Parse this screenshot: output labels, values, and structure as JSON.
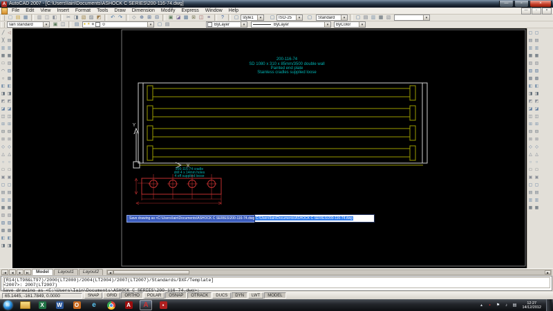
{
  "window": {
    "title": "AutoCAD 2007 - [C:\\Users\\Iain\\Documents\\ASHOCK C SERIES\\200-116-74.dwg]",
    "app_icon_glyph": "A",
    "controls": {
      "minimize": "—",
      "maximize": "▫",
      "close": "×"
    }
  },
  "ui": {
    "dropdown_arrow": "▾",
    "bulb": "●",
    "sun": "☀",
    "lock": "◆",
    "nav": [
      "|◀",
      "◀",
      "▶",
      "▶|"
    ],
    "scroll_left": "◀",
    "scroll_right": "▶"
  },
  "menu": {
    "items": [
      "File",
      "Edit",
      "View",
      "Insert",
      "Format",
      "Tools",
      "Draw",
      "Dimension",
      "Modify",
      "Express",
      "Window",
      "Help"
    ]
  },
  "toolbar_row1": {
    "icons": [
      "new",
      "open",
      "save",
      "|",
      "plot",
      "plot-preview",
      "publish",
      "|",
      "cut",
      "copy",
      "paste",
      "match-properties",
      "block-editor",
      "|",
      "undo",
      "redo",
      "|",
      "pan-realtime",
      "zoom-realtime",
      "zoom-window",
      "zoom-previous",
      "|",
      "properties",
      "designcenter",
      "tool-palettes",
      "sheet-set-manager",
      "markup-set-manager",
      "quickcalc",
      "|",
      "help"
    ],
    "mid_icons_1": [
      "text-style-manager"
    ],
    "style_value": "style1",
    "mid_icons_2": [
      "dimension-style-manager"
    ],
    "dimstyle_value": "ISO-25",
    "mid_icons_3": [
      "table-style-manager"
    ],
    "standard_value": "Standard",
    "styles_icons": [
      "text-style",
      "dimension-style",
      "table-style",
      "multileader-style",
      "plot-style"
    ],
    "workspace_value": ""
  },
  "toolbar_row2": {
    "textstyle_value": "Iain standard",
    "style_icons": [
      "make-current",
      "update-style"
    ],
    "layer_manager_icons": [
      "layer-properties-manager"
    ],
    "layer_value": "0",
    "after_layer_icons": [
      "make-object-layer-current",
      "layer-previous"
    ],
    "color_value": "ByLayer",
    "linetype_value": "ByLayer",
    "plotstyle_value": "ByColor"
  },
  "left_toolbar_draw": [
    "line",
    "construction-line",
    "polyline",
    "polygon",
    "rectangle",
    "arc",
    "circle",
    "revision-cloud",
    "spline",
    "ellipse",
    "ellipse-arc",
    "insert-block",
    "make-block",
    "point",
    "hatch",
    "gradient",
    "region",
    "table",
    "multiline-text",
    "ray",
    "divide",
    "measure",
    "boundary",
    "wipeout",
    "donut",
    "sketch",
    "solid",
    "3d-polyline",
    "helix"
  ],
  "left_toolbar_modify": [
    "erase",
    "copy-object",
    "mirror",
    "offset",
    "array",
    "move",
    "rotate",
    "scale",
    "stretch",
    "trim",
    "extend",
    "break-at-point",
    "break",
    "join",
    "chamfer",
    "fillet",
    "explode",
    "polyline-edit",
    "spline-edit",
    "hatch-edit",
    "align",
    "lengthen",
    "group",
    "ungroup",
    "regen",
    "redraw",
    "named-views",
    "ucs",
    "object-properties"
  ],
  "right_toolbar_dimension": [
    "dim-linear",
    "dim-aligned",
    "dim-arc-length",
    "dim-ordinate",
    "dim-radius",
    "dim-jogged",
    "dim-diameter",
    "dim-angular",
    "quick-dimension",
    "dim-baseline",
    "dim-continue",
    "quick-leader",
    "tolerance",
    "center-mark",
    "dim-edit",
    "dim-text-edit",
    "dim-update",
    "dim-style",
    "distance",
    "area",
    "mass-properties",
    "list",
    "id-point",
    "time"
  ],
  "right_toolbar_osnap": [
    "osnap-endpoint",
    "osnap-midpoint",
    "osnap-intersection",
    "osnap-apparent-intersection",
    "osnap-extension",
    "osnap-center",
    "osnap-quadrant",
    "osnap-tangent",
    "osnap-perpendicular",
    "osnap-parallel",
    "osnap-insert",
    "osnap-node",
    "osnap-nearest",
    "osnap-none",
    "osnap-settings",
    "draworder-bring-to-front",
    "draworder-send-to-back",
    "draworder-above",
    "draworder-below",
    "render",
    "3d-orbit",
    "named-ucs",
    "view-top",
    "camera"
  ],
  "drawing": {
    "title_note_lines": [
      "200-116-74",
      "SD 1080 x 310 x 85mm/3500 double wall",
      "Painted end plate",
      "Stainless cradles supplied loose"
    ],
    "detail_note_lines": [
      "200-116-74 cradle",
      "drill 4 x 14mm holes",
      "4 off supplied loose"
    ],
    "ucs_labels": {
      "x": "X",
      "y": "Y"
    },
    "prompt_text": "Save drawing as <C:\\Users\\Iain\\Documents\\ASHOCK C SERIES\\200-116-74.dwg>:",
    "prompt_input_value": "C:\\Users\\Iain\\Documents\\ASHOCK C SERIES\\200-116-74.dwg",
    "colors": {
      "geometry_yellow": "#9c9c00",
      "geometry_white": "#d4d4d4",
      "annotation_cyan": "#00b5b5",
      "detail_red": "#c23030",
      "sheet_border": "#7a7a7a",
      "background": "#000000",
      "prompt_blue": "#3d5ebe",
      "selection_blue": "#2f7df0"
    }
  },
  "tabs": {
    "items": [
      "Model",
      "Layout1",
      "Layout2"
    ],
    "active": "Model"
  },
  "command": {
    "lines": [
      "[R14(LT98&LT97)/2000(LT2000)/2004(LT2004)/2007(LT2007)/Standards/DXF/Template]",
      "<2007>: 2007(LT2007)",
      "Save drawing as <C:\\Users\\Iain\\Documents\\ASHOCK C SERIES\\200-116-74.dwg>:"
    ]
  },
  "status": {
    "coordinates": "65.1445, -161.7849, 0.0000",
    "buttons": [
      {
        "label": "SNAP",
        "active": false
      },
      {
        "label": "GRID",
        "active": false
      },
      {
        "label": "ORTHO",
        "active": true
      },
      {
        "label": "POLAR",
        "active": false
      },
      {
        "label": "OSNAP",
        "active": true
      },
      {
        "label": "OTRACK",
        "active": true
      },
      {
        "label": "DUCS",
        "active": false
      },
      {
        "label": "DYN",
        "active": true
      },
      {
        "label": "LWT",
        "active": false
      },
      {
        "label": "MODEL",
        "active": true
      }
    ]
  },
  "taskbar": {
    "items": [
      {
        "name": "start-button",
        "type": "start",
        "glyph": "⊞",
        "active": false
      },
      {
        "name": "windows-explorer",
        "type": "folder",
        "active": false
      },
      {
        "name": "excel",
        "glyph": "X",
        "bg": "#217346",
        "active": false
      },
      {
        "name": "word",
        "glyph": "W",
        "bg": "#2b579a",
        "active": false
      },
      {
        "name": "outlook",
        "glyph": "O",
        "bg": "#c96a1e",
        "active": false
      },
      {
        "name": "internet-explorer",
        "glyph": "e",
        "fg": "#5ac8f5",
        "active": false
      },
      {
        "name": "chrome",
        "type": "chrome",
        "active": false
      },
      {
        "name": "adobe-reader",
        "glyph": "A",
        "bg": "#9b0d0e",
        "active": false
      },
      {
        "name": "autocad",
        "glyph": "A",
        "fg": "#d03434",
        "active": true
      },
      {
        "name": "app-red",
        "glyph": "▪",
        "bg": "#b02020",
        "active": false
      }
    ],
    "tray": [
      {
        "name": "show-hidden-icons",
        "glyph": "▴",
        "color": "#cfd6de"
      },
      {
        "name": "antivirus",
        "glyph": "▪",
        "color": "#e03030"
      },
      {
        "name": "action-center",
        "glyph": "⚑",
        "color": "#e8eef5"
      },
      {
        "name": "volume",
        "glyph": "♪",
        "color": "#e8eef5"
      },
      {
        "name": "network",
        "glyph": "▤",
        "color": "#e8eef5"
      }
    ],
    "clock_time": "12:27",
    "clock_date": "14/12/2012"
  }
}
